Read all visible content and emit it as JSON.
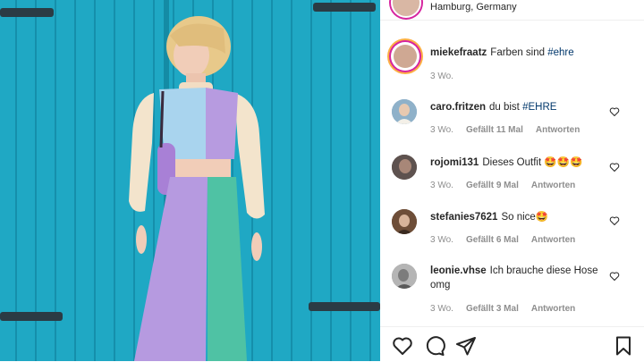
{
  "post": {
    "location": "Hamburg, Germany",
    "caption": {
      "username": "miekefraatz",
      "text": "Farben sind",
      "hashtag": "#ehre",
      "age": "3 Wo."
    }
  },
  "comments": [
    {
      "username": "caro.fritzen",
      "text": "du bist",
      "hashtag": "#EHRE",
      "age": "3 Wo.",
      "likes": "Gefällt 11 Mal",
      "reply": "Antworten"
    },
    {
      "username": "rojomi131",
      "text": "Dieses Outfit 🤩🤩🤩",
      "hashtag": "",
      "age": "3 Wo.",
      "likes": "Gefällt 9 Mal",
      "reply": "Antworten"
    },
    {
      "username": "stefanies7621",
      "text": "So nice🤩",
      "hashtag": "",
      "age": "3 Wo.",
      "likes": "Gefällt 6 Mal",
      "reply": "Antworten"
    },
    {
      "username": "leonie.vhse",
      "text": "Ich brauche diese Hose omg",
      "hashtag": "",
      "age": "3 Wo.",
      "likes": "Gefällt 3 Mal",
      "reply": "Antworten"
    }
  ],
  "icons": {
    "like": "heart-icon",
    "comment": "comment-icon",
    "share": "share-icon",
    "save": "bookmark-icon"
  },
  "colors": {
    "wall": "#1fa8c4",
    "hashtag": "#00376b",
    "meta": "#8e8e8e",
    "story_ring": "#d6249f"
  }
}
